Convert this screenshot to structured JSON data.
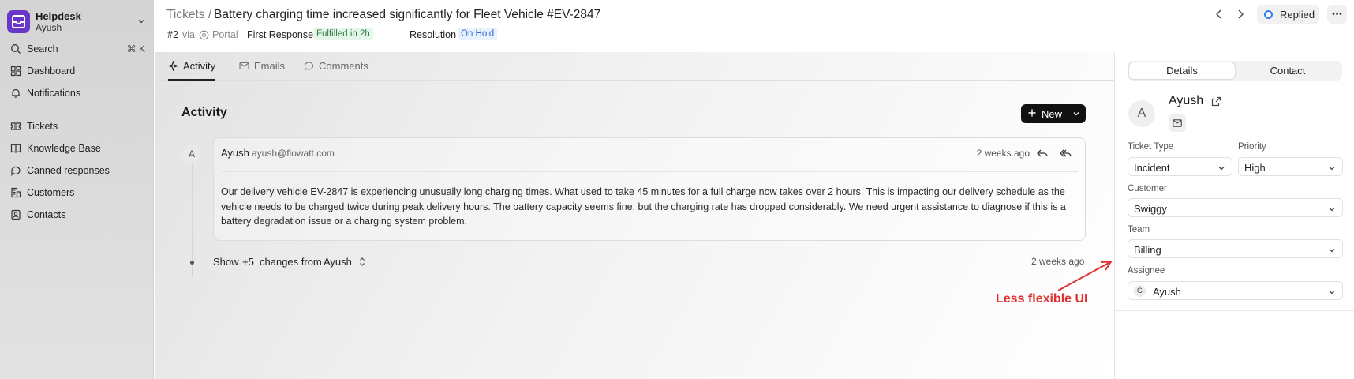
{
  "sidebar": {
    "app_name": "Helpdesk",
    "user": "Ayush",
    "items": [
      {
        "label": "Search",
        "shortcut": "⌘ K",
        "icon": "search-icon"
      },
      {
        "label": "Dashboard",
        "icon": "dashboard-icon"
      },
      {
        "label": "Notifications",
        "icon": "bell-icon"
      },
      {
        "label": "Tickets",
        "icon": "ticket-icon"
      },
      {
        "label": "Knowledge Base",
        "icon": "book-icon"
      },
      {
        "label": "Canned responses",
        "icon": "message-icon"
      },
      {
        "label": "Customers",
        "icon": "building-icon"
      },
      {
        "label": "Contacts",
        "icon": "contact-icon"
      }
    ]
  },
  "header": {
    "breadcrumb_root": "Tickets /",
    "ticket_title": "Battery charging time increased significantly for Fleet Vehicle #EV-2847",
    "ticket_id": "#2",
    "via": "via",
    "channel": "Portal",
    "first_response_label": "First Response",
    "first_response_status": "Fulfilled in 2h",
    "resolution_label": "Resolution",
    "resolution_status": "On Hold",
    "status": "Replied"
  },
  "tabs": [
    {
      "label": "Activity",
      "active": true
    },
    {
      "label": "Emails",
      "active": false
    },
    {
      "label": "Comments",
      "active": false
    }
  ],
  "activity": {
    "title": "Activity",
    "new_button": "New",
    "email": {
      "avatar": "A",
      "from_name": "Ayush",
      "from_email": "ayush@flowatt.com",
      "time": "2 weeks ago",
      "body": "Our delivery vehicle EV-2847 is experiencing unusually long charging times. What used to take 45 minutes for a full charge now takes over 2 hours. This is impacting our delivery schedule as the vehicle needs to be charged twice during peak delivery hours. The battery capacity seems fine, but the charging rate has dropped considerably. We need urgent assistance to diagnose if this is a battery degradation issue or a charging system problem."
    },
    "changes": {
      "show": "Show",
      "count": "+5",
      "changes_from": "changes from",
      "user": "Ayush",
      "time": "2 weeks ago"
    }
  },
  "annotation": {
    "text": "Less flexible UI",
    "color": "#e0312f"
  },
  "details": {
    "tabs": [
      "Details",
      "Contact"
    ],
    "contact": {
      "avatar": "A",
      "name": "Ayush"
    },
    "fields": {
      "ticket_type": {
        "label": "Ticket Type",
        "value": "Incident"
      },
      "priority": {
        "label": "Priority",
        "value": "High"
      },
      "customer": {
        "label": "Customer",
        "value": "Swiggy"
      },
      "team": {
        "label": "Team",
        "value": "Billing"
      },
      "assignee": {
        "label": "Assignee",
        "value": "Ayush",
        "avatar": "G"
      }
    }
  }
}
